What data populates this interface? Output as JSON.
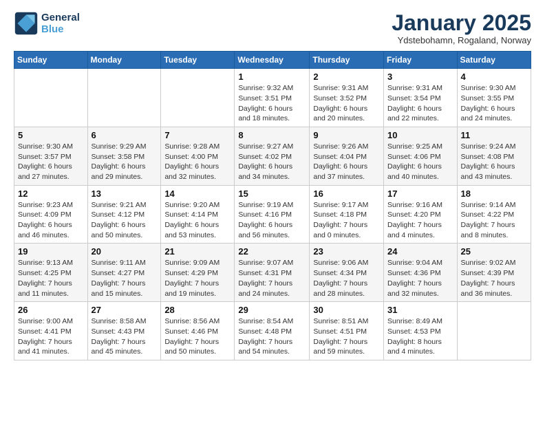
{
  "logo": {
    "line1": "General",
    "line2": "Blue"
  },
  "title": "January 2025",
  "subtitle": "Ydstebohamn, Rogaland, Norway",
  "weekdays": [
    "Sunday",
    "Monday",
    "Tuesday",
    "Wednesday",
    "Thursday",
    "Friday",
    "Saturday"
  ],
  "weeks": [
    [
      {
        "day": "",
        "sunrise": "",
        "sunset": "",
        "daylight": ""
      },
      {
        "day": "",
        "sunrise": "",
        "sunset": "",
        "daylight": ""
      },
      {
        "day": "",
        "sunrise": "",
        "sunset": "",
        "daylight": ""
      },
      {
        "day": "1",
        "sunrise": "Sunrise: 9:32 AM",
        "sunset": "Sunset: 3:51 PM",
        "daylight": "Daylight: 6 hours and 18 minutes."
      },
      {
        "day": "2",
        "sunrise": "Sunrise: 9:31 AM",
        "sunset": "Sunset: 3:52 PM",
        "daylight": "Daylight: 6 hours and 20 minutes."
      },
      {
        "day": "3",
        "sunrise": "Sunrise: 9:31 AM",
        "sunset": "Sunset: 3:54 PM",
        "daylight": "Daylight: 6 hours and 22 minutes."
      },
      {
        "day": "4",
        "sunrise": "Sunrise: 9:30 AM",
        "sunset": "Sunset: 3:55 PM",
        "daylight": "Daylight: 6 hours and 24 minutes."
      }
    ],
    [
      {
        "day": "5",
        "sunrise": "Sunrise: 9:30 AM",
        "sunset": "Sunset: 3:57 PM",
        "daylight": "Daylight: 6 hours and 27 minutes."
      },
      {
        "day": "6",
        "sunrise": "Sunrise: 9:29 AM",
        "sunset": "Sunset: 3:58 PM",
        "daylight": "Daylight: 6 hours and 29 minutes."
      },
      {
        "day": "7",
        "sunrise": "Sunrise: 9:28 AM",
        "sunset": "Sunset: 4:00 PM",
        "daylight": "Daylight: 6 hours and 32 minutes."
      },
      {
        "day": "8",
        "sunrise": "Sunrise: 9:27 AM",
        "sunset": "Sunset: 4:02 PM",
        "daylight": "Daylight: 6 hours and 34 minutes."
      },
      {
        "day": "9",
        "sunrise": "Sunrise: 9:26 AM",
        "sunset": "Sunset: 4:04 PM",
        "daylight": "Daylight: 6 hours and 37 minutes."
      },
      {
        "day": "10",
        "sunrise": "Sunrise: 9:25 AM",
        "sunset": "Sunset: 4:06 PM",
        "daylight": "Daylight: 6 hours and 40 minutes."
      },
      {
        "day": "11",
        "sunrise": "Sunrise: 9:24 AM",
        "sunset": "Sunset: 4:08 PM",
        "daylight": "Daylight: 6 hours and 43 minutes."
      }
    ],
    [
      {
        "day": "12",
        "sunrise": "Sunrise: 9:23 AM",
        "sunset": "Sunset: 4:09 PM",
        "daylight": "Daylight: 6 hours and 46 minutes."
      },
      {
        "day": "13",
        "sunrise": "Sunrise: 9:21 AM",
        "sunset": "Sunset: 4:12 PM",
        "daylight": "Daylight: 6 hours and 50 minutes."
      },
      {
        "day": "14",
        "sunrise": "Sunrise: 9:20 AM",
        "sunset": "Sunset: 4:14 PM",
        "daylight": "Daylight: 6 hours and 53 minutes."
      },
      {
        "day": "15",
        "sunrise": "Sunrise: 9:19 AM",
        "sunset": "Sunset: 4:16 PM",
        "daylight": "Daylight: 6 hours and 56 minutes."
      },
      {
        "day": "16",
        "sunrise": "Sunrise: 9:17 AM",
        "sunset": "Sunset: 4:18 PM",
        "daylight": "Daylight: 7 hours and 0 minutes."
      },
      {
        "day": "17",
        "sunrise": "Sunrise: 9:16 AM",
        "sunset": "Sunset: 4:20 PM",
        "daylight": "Daylight: 7 hours and 4 minutes."
      },
      {
        "day": "18",
        "sunrise": "Sunrise: 9:14 AM",
        "sunset": "Sunset: 4:22 PM",
        "daylight": "Daylight: 7 hours and 8 minutes."
      }
    ],
    [
      {
        "day": "19",
        "sunrise": "Sunrise: 9:13 AM",
        "sunset": "Sunset: 4:25 PM",
        "daylight": "Daylight: 7 hours and 11 minutes."
      },
      {
        "day": "20",
        "sunrise": "Sunrise: 9:11 AM",
        "sunset": "Sunset: 4:27 PM",
        "daylight": "Daylight: 7 hours and 15 minutes."
      },
      {
        "day": "21",
        "sunrise": "Sunrise: 9:09 AM",
        "sunset": "Sunset: 4:29 PM",
        "daylight": "Daylight: 7 hours and 19 minutes."
      },
      {
        "day": "22",
        "sunrise": "Sunrise: 9:07 AM",
        "sunset": "Sunset: 4:31 PM",
        "daylight": "Daylight: 7 hours and 24 minutes."
      },
      {
        "day": "23",
        "sunrise": "Sunrise: 9:06 AM",
        "sunset": "Sunset: 4:34 PM",
        "daylight": "Daylight: 7 hours and 28 minutes."
      },
      {
        "day": "24",
        "sunrise": "Sunrise: 9:04 AM",
        "sunset": "Sunset: 4:36 PM",
        "daylight": "Daylight: 7 hours and 32 minutes."
      },
      {
        "day": "25",
        "sunrise": "Sunrise: 9:02 AM",
        "sunset": "Sunset: 4:39 PM",
        "daylight": "Daylight: 7 hours and 36 minutes."
      }
    ],
    [
      {
        "day": "26",
        "sunrise": "Sunrise: 9:00 AM",
        "sunset": "Sunset: 4:41 PM",
        "daylight": "Daylight: 7 hours and 41 minutes."
      },
      {
        "day": "27",
        "sunrise": "Sunrise: 8:58 AM",
        "sunset": "Sunset: 4:43 PM",
        "daylight": "Daylight: 7 hours and 45 minutes."
      },
      {
        "day": "28",
        "sunrise": "Sunrise: 8:56 AM",
        "sunset": "Sunset: 4:46 PM",
        "daylight": "Daylight: 7 hours and 50 minutes."
      },
      {
        "day": "29",
        "sunrise": "Sunrise: 8:54 AM",
        "sunset": "Sunset: 4:48 PM",
        "daylight": "Daylight: 7 hours and 54 minutes."
      },
      {
        "day": "30",
        "sunrise": "Sunrise: 8:51 AM",
        "sunset": "Sunset: 4:51 PM",
        "daylight": "Daylight: 7 hours and 59 minutes."
      },
      {
        "day": "31",
        "sunrise": "Sunrise: 8:49 AM",
        "sunset": "Sunset: 4:53 PM",
        "daylight": "Daylight: 8 hours and 4 minutes."
      },
      {
        "day": "",
        "sunrise": "",
        "sunset": "",
        "daylight": ""
      }
    ]
  ]
}
